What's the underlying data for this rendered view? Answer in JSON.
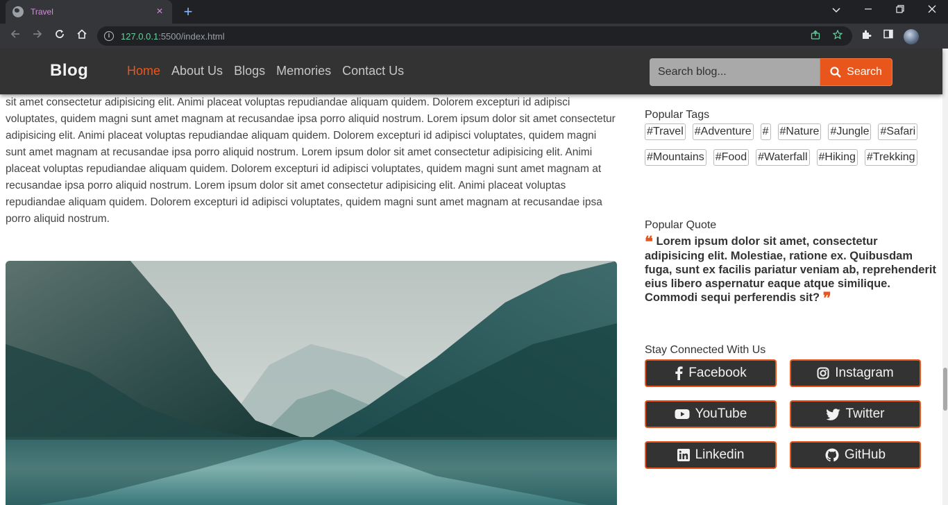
{
  "browser": {
    "tab_title": "Travel",
    "url_host": "127.0.0.1",
    "url_rest": ":5500/index.html"
  },
  "navbar": {
    "brand": "Blog",
    "links": [
      "Home",
      "About Us",
      "Blogs",
      "Memories",
      "Contact Us"
    ],
    "active_link": "Home",
    "search_placeholder": "Search blog...",
    "search_button": "Search"
  },
  "article": {
    "paragraph": "excepturi id adipisci voluptates, quidem magni sunt amet magnam at recusandae ipsa porro aliquid nostrum. Lorem ipsum dolor sit amet consectetur adipisicing elit. Animi placeat voluptas repudiandae aliquam quidem. Dolorem excepturi id adipisci voluptates, quidem magni sunt amet magnam at recusandae ipsa porro aliquid nostrum. Lorem ipsum dolor sit amet consectetur adipisicing elit. Animi placeat voluptas repudiandae aliquam quidem. Dolorem excepturi id adipisci voluptates, quidem magni sunt amet magnam at recusandae ipsa porro aliquid nostrum. Lorem ipsum dolor sit amet consectetur adipisicing elit. Animi placeat voluptas repudiandae aliquam quidem. Dolorem excepturi id adipisci voluptates, quidem magni sunt amet magnam at recusandae ipsa porro aliquid nostrum. Lorem ipsum dolor sit amet consectetur adipisicing elit. Animi placeat voluptas repudiandae aliquam quidem. Dolorem excepturi id adipisci voluptates, quidem magni sunt amet magnam at recusandae ipsa porro aliquid nostrum."
  },
  "sidebar": {
    "tags_heading": "Popular Tags",
    "tags": [
      "#Travel",
      "#Adventure",
      "#",
      "#Nature",
      "#Jungle",
      "#Safari",
      "#Mountains",
      "#Food",
      "#Waterfall",
      "#Hiking",
      "#Trekking"
    ],
    "quote_heading": "Popular Quote",
    "quote": "Lorem ipsum dolor sit amet, consectetur adipisicing elit. Molestiae, ratione ex. Quibusdam fuga, sunt ex facilis pariatur veniam ab, reprehenderit eius libero aspernatur eaque atque similique. Commodi sequi perferendis sit?",
    "social_heading": "Stay Connected With Us",
    "social": [
      {
        "label": "Facebook",
        "icon": "facebook-icon"
      },
      {
        "label": "Instagram",
        "icon": "instagram-icon"
      },
      {
        "label": "YouTube",
        "icon": "youtube-icon"
      },
      {
        "label": "Twitter",
        "icon": "twitter-icon"
      },
      {
        "label": "Linkedin",
        "icon": "linkedin-icon"
      },
      {
        "label": "GitHub",
        "icon": "github-icon"
      }
    ]
  },
  "colors": {
    "accent": "#e8561c",
    "navbar_bg": "#333333",
    "tab_title": "#d88ae0"
  }
}
